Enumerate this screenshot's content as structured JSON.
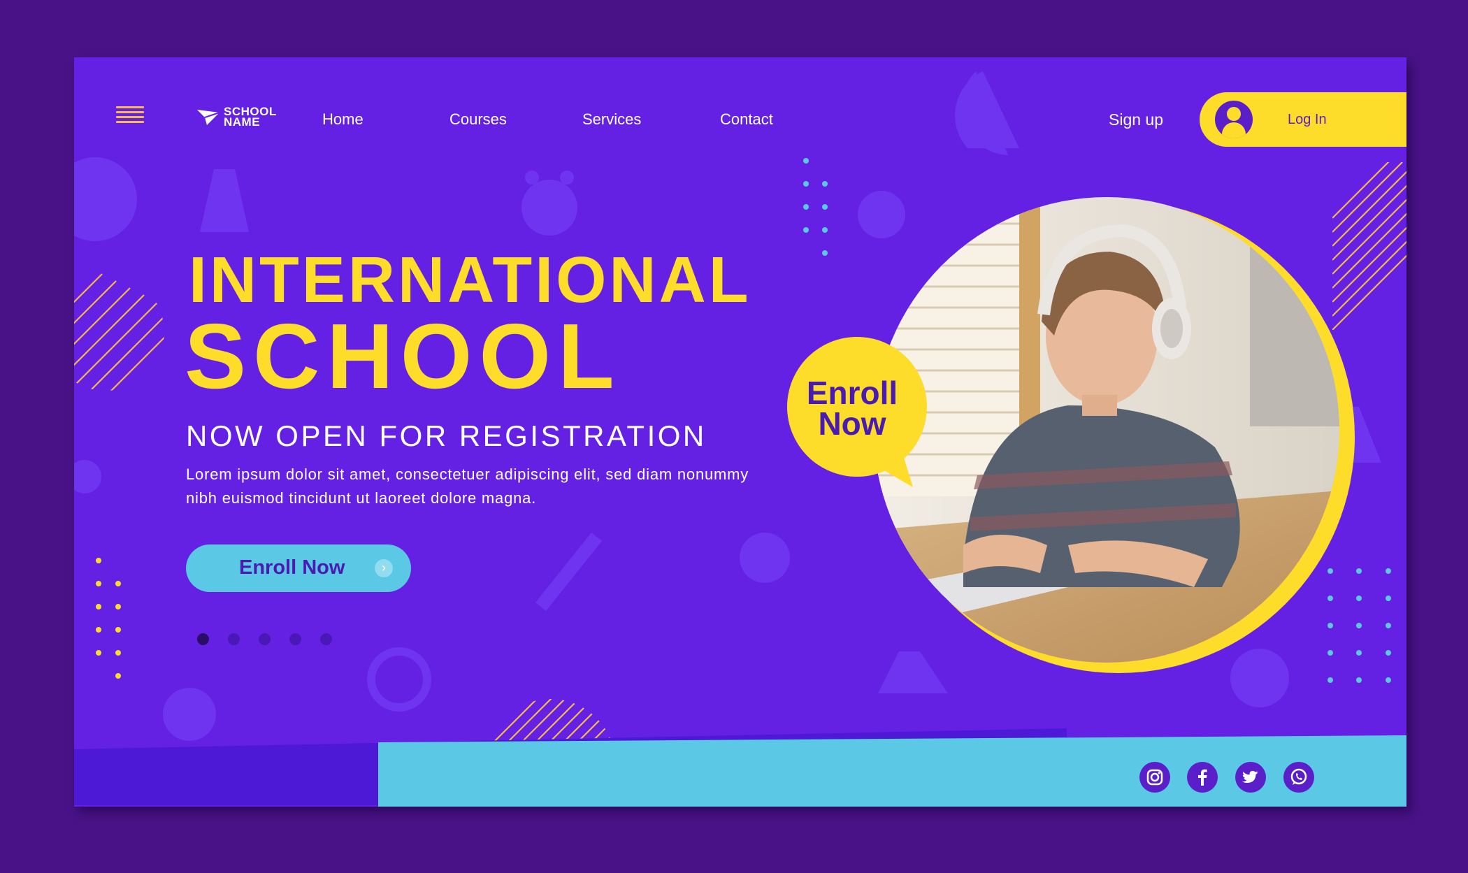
{
  "brand": {
    "logo_line1": "SCHOOL",
    "logo_line2": "NAME"
  },
  "nav": {
    "items": [
      "Home",
      "Courses",
      "Services",
      "Contact"
    ]
  },
  "auth": {
    "signup_label": "Sign up",
    "login_label": "Log In"
  },
  "hero": {
    "title_line1": "INTERNATIONAL",
    "title_line2": "SCHOOL",
    "subtitle": "NOW OPEN FOR REGISTRATION",
    "description": "Lorem ipsum dolor sit amet, consectetuer adipiscing elit, sed diam nonummy nibh euismod tincidunt ut laoreet dolore magna.",
    "cta_label": "Enroll Now",
    "bubble_line1": "Enroll",
    "bubble_line2": "Now"
  },
  "carousel": {
    "slide_count": 5,
    "active_index": 0
  },
  "social": {
    "icons": [
      "instagram-icon",
      "facebook-icon",
      "twitter-icon",
      "whatsapp-icon"
    ]
  },
  "colors": {
    "background": "#4a1287",
    "card": "#6421e3",
    "accent_yellow": "#fddc2a",
    "accent_cyan": "#5bc8e6",
    "dark_purple": "#4a1bb0"
  }
}
